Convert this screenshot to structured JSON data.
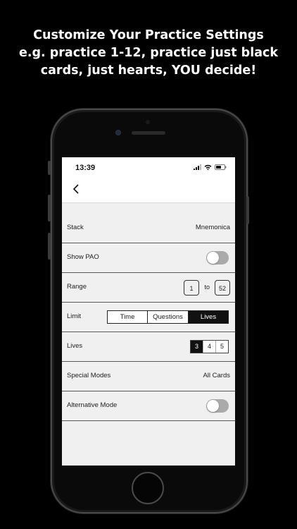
{
  "caption": {
    "line1": "Customize Your Practice Settings",
    "line2": "e.g. practice 1-12, practice just black",
    "line3": "cards, just hearts, YOU decide!"
  },
  "status_bar": {
    "time": "13:39"
  },
  "settings": {
    "stack": {
      "label": "Stack",
      "value": "Mnemonica"
    },
    "show_pao": {
      "label": "Show PAO",
      "enabled": false
    },
    "range": {
      "label": "Range",
      "from": "1",
      "to_label": "to",
      "to": "52"
    },
    "limit": {
      "label": "Limit",
      "options": [
        "Time",
        "Questions",
        "Lives"
      ],
      "selected": "Lives"
    },
    "lives": {
      "label": "Lives",
      "options": [
        "3",
        "4",
        "5"
      ],
      "selected": "3"
    },
    "special_modes": {
      "label": "Special Modes",
      "value": "All Cards"
    },
    "alternative_mode": {
      "label": "Alternative Mode",
      "enabled": false
    }
  },
  "colors": {
    "background": "#000000",
    "screen": "#f0f0f0",
    "selected": "#111111",
    "toggle_off": "#aaaaaa"
  }
}
